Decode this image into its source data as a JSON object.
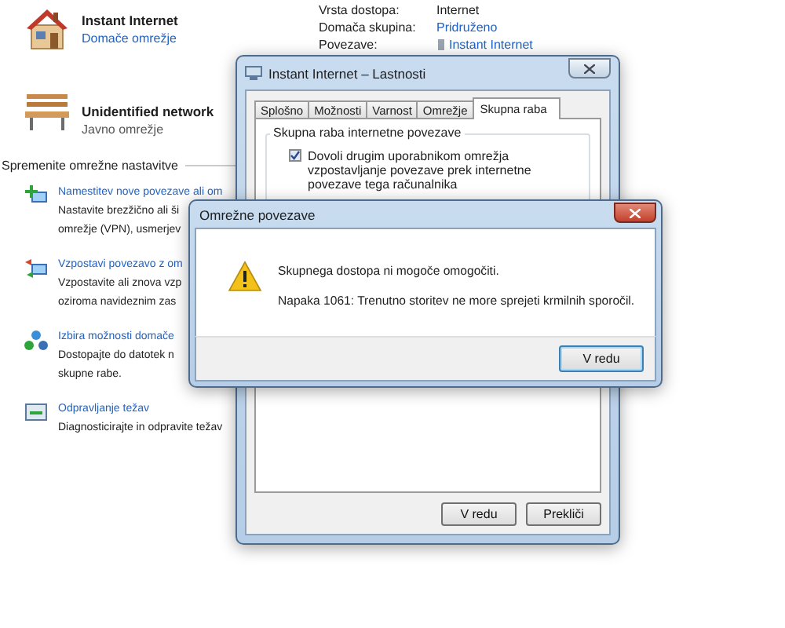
{
  "networks": [
    {
      "name": "Instant Internet",
      "category": "Domače omrežje"
    },
    {
      "name": "Unidentified network",
      "category": "Javno omrežje"
    }
  ],
  "details": [
    {
      "label": "Vrsta dostopa:",
      "value": "Internet",
      "kind": "text"
    },
    {
      "label": "Domača skupina:",
      "value": "Pridruženo",
      "kind": "link"
    },
    {
      "label": "Povezave:",
      "value": "Instant Internet",
      "kind": "connection"
    }
  ],
  "settings": {
    "heading": "Spremenite omrežne nastavitve",
    "tasks": [
      {
        "link": "Namestitev nove povezave ali om",
        "description": [
          "Nastavite brezžično ali ši",
          "omrežje (VPN), usmerjev"
        ]
      },
      {
        "link": "Vzpostavi povezavo z om",
        "description": [
          "Vzpostavite ali znova vzp",
          "oziroma navideznim zas"
        ]
      },
      {
        "link": "Izbira možnosti domače",
        "description": [
          "Dostopajte do datotek n",
          "skupne rabe."
        ]
      },
      {
        "link": "Odpravljanje težav",
        "description": [
          "Diagnosticirajte in odpravite težav"
        ]
      }
    ]
  },
  "properties_dialog": {
    "title": "Instant Internet – Lastnosti",
    "tabs": [
      {
        "label": "Splošno",
        "selected": false
      },
      {
        "label": "Možnosti",
        "selected": false
      },
      {
        "label": "Varnost",
        "selected": false
      },
      {
        "label": "Omrežje",
        "selected": false
      },
      {
        "label": "Skupna raba",
        "selected": true
      }
    ],
    "group_title": "Skupna raba internetne povezave",
    "checkbox": {
      "label": "Dovoli drugim uporabnikom omrežja vzpostavljanje povezave prek internetne povezave tega računalnika",
      "checked": true
    },
    "buttons": [
      "V redu",
      "Prekliči"
    ]
  },
  "message_dialog": {
    "title": "Omrežne povezave",
    "message": "Skupnega dostopa ni mogoče omogočiti.",
    "detail": "Napaka 1061: Trenutno storitev ne more sprejeti krmilnih sporočil.",
    "button": "V redu"
  }
}
